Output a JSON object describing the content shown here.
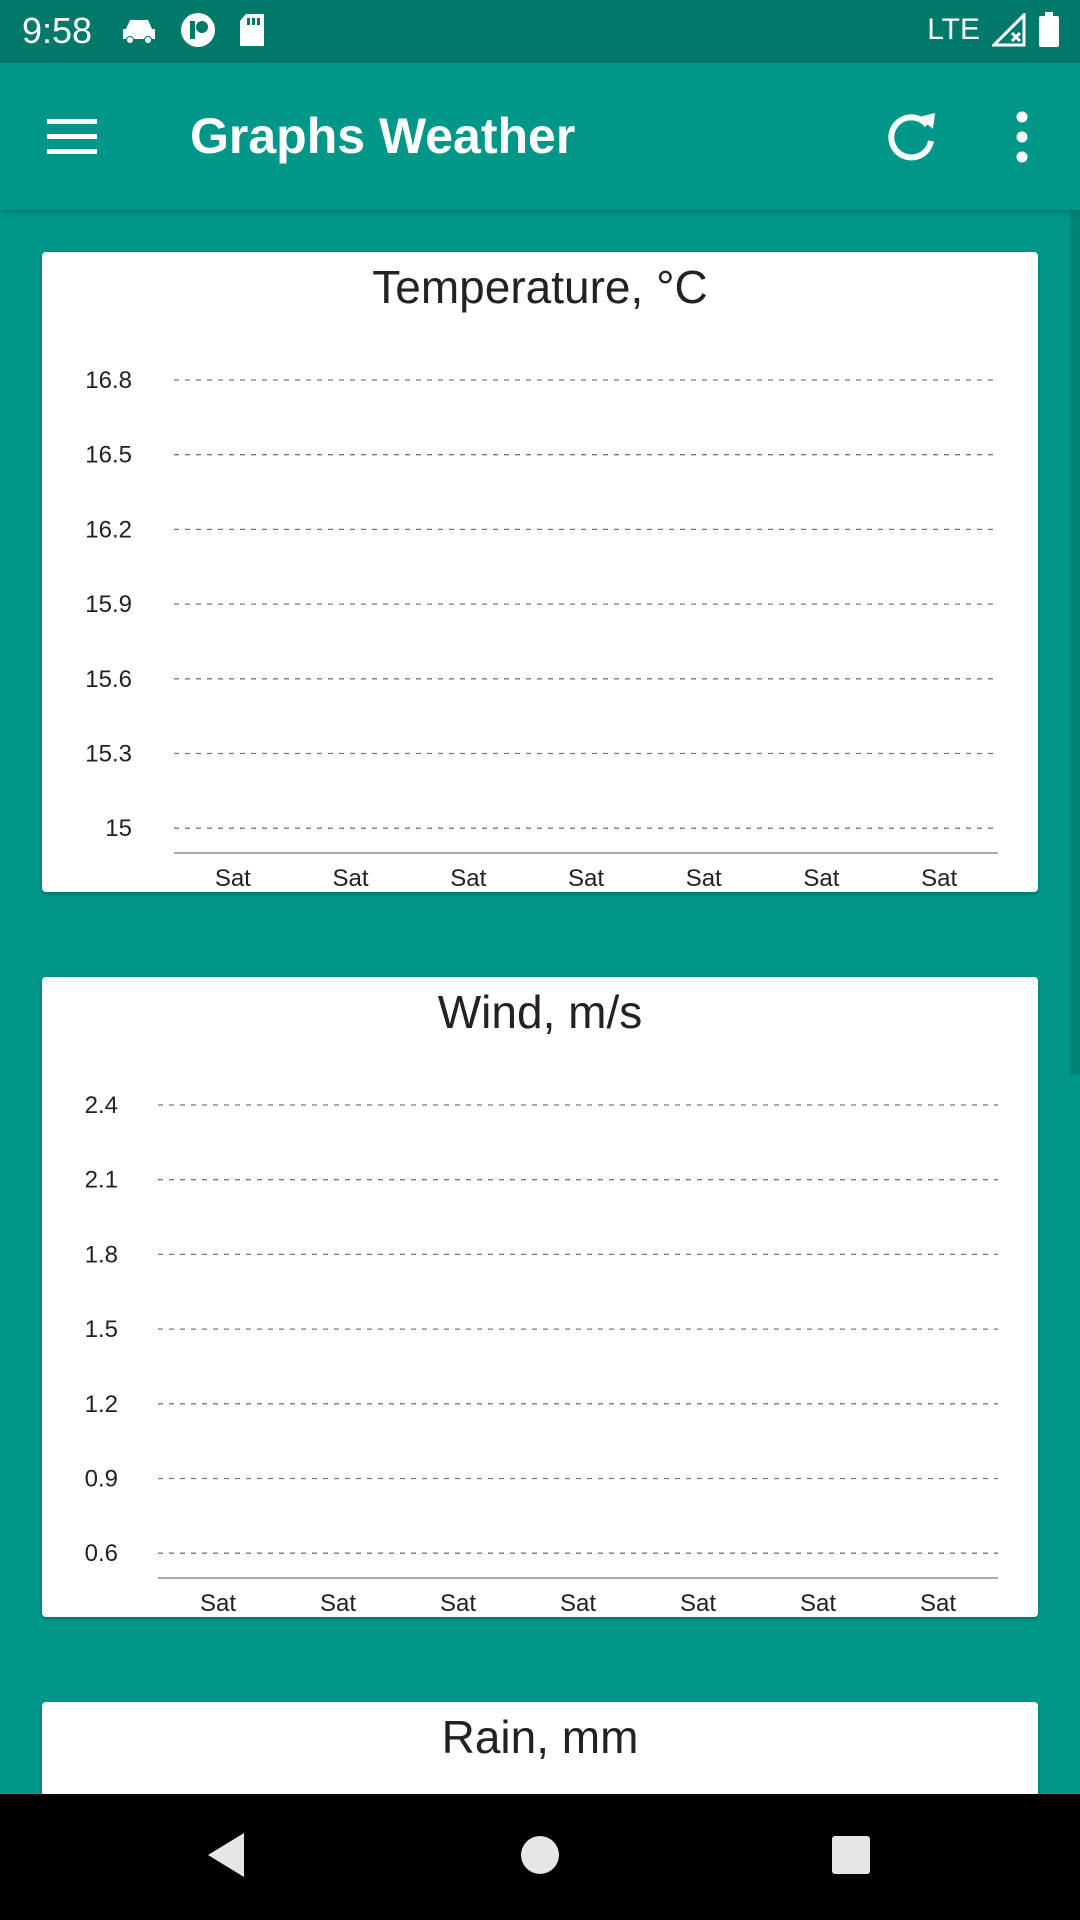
{
  "status_bar": {
    "time": "9:58",
    "network": "LTE",
    "icons": [
      "car-icon",
      "app-icon",
      "sd-card-icon",
      "signal-icon",
      "battery-icon"
    ]
  },
  "app_bar": {
    "title": "Graphs Weather",
    "menu_icon": "hamburger-menu-icon",
    "refresh_icon": "refresh-icon",
    "more_icon": "more-vert-icon"
  },
  "colors": {
    "primary": "#009688",
    "primary_dark": "#00796b"
  },
  "chart_data": [
    {
      "type": "line",
      "title": "Temperature, °C",
      "categories": [
        "Sat",
        "Sat",
        "Sat",
        "Sat",
        "Sat",
        "Sat",
        "Sat"
      ],
      "y_ticks": [
        "16.8",
        "16.5",
        "16.2",
        "15.9",
        "15.6",
        "15.3",
        "15"
      ],
      "ylim": [
        15,
        16.8
      ],
      "grid": true,
      "series": []
    },
    {
      "type": "line",
      "title": "Wind, m/s",
      "categories": [
        "Sat",
        "Sat",
        "Sat",
        "Sat",
        "Sat",
        "Sat",
        "Sat"
      ],
      "y_ticks": [
        "2.4",
        "2.1",
        "1.8",
        "1.5",
        "1.2",
        "0.9",
        "0.6"
      ],
      "ylim": [
        0.6,
        2.4
      ],
      "grid": true,
      "series": []
    },
    {
      "type": "line",
      "title": "Rain, mm",
      "categories": [],
      "y_ticks": [],
      "grid": true,
      "series": []
    }
  ],
  "nav_bar": {
    "back_icon": "back-icon",
    "home_icon": "home-icon",
    "recents_icon": "recents-icon"
  }
}
